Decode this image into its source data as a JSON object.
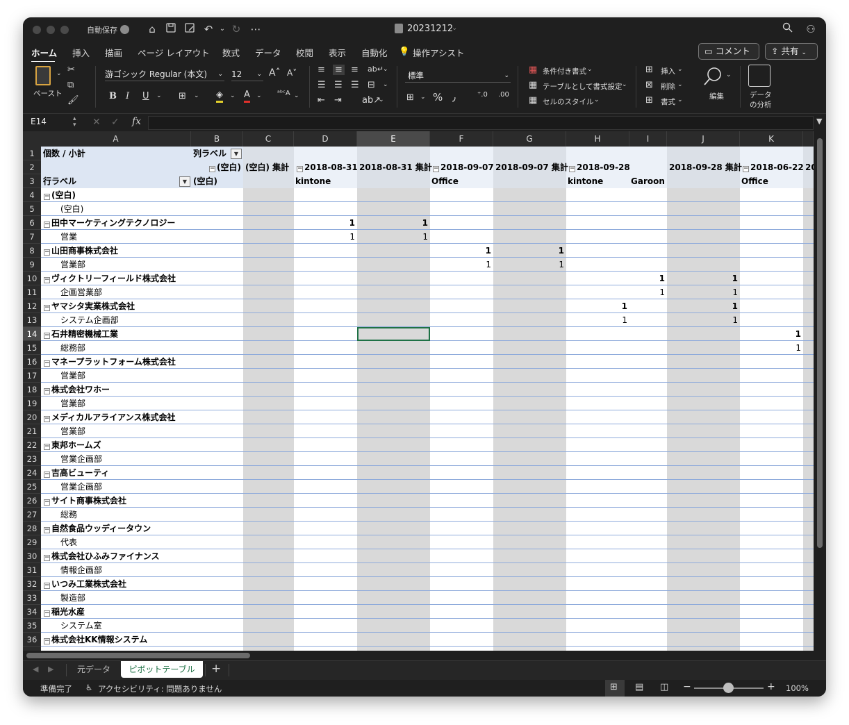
{
  "titlebar": {
    "autosave_label": "自動保存",
    "doc_title": "20231212"
  },
  "ribbon_tabs": [
    "ホーム",
    "挿入",
    "描画",
    "ページ レイアウト",
    "数式",
    "データ",
    "校閲",
    "表示",
    "自動化",
    "操作アシスト"
  ],
  "actions": {
    "comment": "コメント",
    "share": "共有"
  },
  "ribbon": {
    "paste": "ペースト",
    "font_name": "游ゴシック Regular (本文)",
    "font_size": "12",
    "number_format": "標準",
    "conditional_format": "条件付き書式",
    "format_as_table": "テーブルとして書式設定",
    "cell_styles": "セルのスタイル",
    "insert": "挿入",
    "delete": "削除",
    "format": "書式",
    "edit": "編集",
    "analyze_line1": "データ",
    "analyze_line2": "の分析"
  },
  "formula_bar": {
    "name_box": "E14",
    "fx": "fx",
    "formula": ""
  },
  "columns": [
    "A",
    "B",
    "C",
    "D",
    "E",
    "F",
    "G",
    "H",
    "I",
    "J",
    "K"
  ],
  "selected_column": "E",
  "selected_row": 14,
  "pivot": {
    "r1": {
      "a": "個数 / 小計",
      "b": "列ラベル"
    },
    "r2": {
      "b": "(空白)",
      "c": "(空白) 集計",
      "d": "2018-08-31",
      "e": "2018-08-31 集計",
      "f": "2018-09-07",
      "g": "2018-09-07 集計",
      "h": "2018-09-28",
      "j": "2018-09-28 集計",
      "k": "2018-06-22",
      "l": "20"
    },
    "r3": {
      "a": "行ラベル",
      "b": "(空白)",
      "d": "kintone",
      "f": "Office",
      "h": "kintone",
      "i": "Garoon",
      "k": "Office"
    },
    "rows": [
      {
        "n": 4,
        "label": "(空白)",
        "bold": true,
        "minus": true
      },
      {
        "n": 5,
        "label": "(空白)",
        "bold": false,
        "minus": false
      },
      {
        "n": 6,
        "label": "田中マーケティングテクノロジー",
        "bold": true,
        "minus": true,
        "D": "1",
        "E": "1"
      },
      {
        "n": 7,
        "label": "営業",
        "bold": false,
        "minus": false,
        "D": "1",
        "E": "1"
      },
      {
        "n": 8,
        "label": "山田商事株式会社",
        "bold": true,
        "minus": true,
        "F": "1",
        "G": "1"
      },
      {
        "n": 9,
        "label": "営業部",
        "bold": false,
        "minus": false,
        "F": "1",
        "G": "1"
      },
      {
        "n": 10,
        "label": "ヴィクトリーフィールド株式会社",
        "bold": true,
        "minus": true,
        "I": "1",
        "J": "1"
      },
      {
        "n": 11,
        "label": "企画営業部",
        "bold": false,
        "minus": false,
        "I": "1",
        "J": "1"
      },
      {
        "n": 12,
        "label": "ヤマシタ実業株式会社",
        "bold": true,
        "minus": true,
        "H": "1",
        "J": "1"
      },
      {
        "n": 13,
        "label": "システム企画部",
        "bold": false,
        "minus": false,
        "H": "1",
        "J": "1"
      },
      {
        "n": 14,
        "label": "石井精密機械工業",
        "bold": true,
        "minus": true,
        "K": "1"
      },
      {
        "n": 15,
        "label": "総務部",
        "bold": false,
        "minus": false,
        "K": "1"
      },
      {
        "n": 16,
        "label": "マネープラットフォーム株式会社",
        "bold": true,
        "minus": true
      },
      {
        "n": 17,
        "label": "営業部",
        "bold": false,
        "minus": false
      },
      {
        "n": 18,
        "label": "株式会社ワホー",
        "bold": true,
        "minus": true
      },
      {
        "n": 19,
        "label": "営業部",
        "bold": false,
        "minus": false
      },
      {
        "n": 20,
        "label": "メディカルアライアンス株式会社",
        "bold": true,
        "minus": true
      },
      {
        "n": 21,
        "label": "営業部",
        "bold": false,
        "minus": false
      },
      {
        "n": 22,
        "label": "東邦ホームズ",
        "bold": true,
        "minus": true
      },
      {
        "n": 23,
        "label": "営業企画部",
        "bold": false,
        "minus": false
      },
      {
        "n": 24,
        "label": "吉高ビューティ",
        "bold": true,
        "minus": true
      },
      {
        "n": 25,
        "label": "営業企画部",
        "bold": false,
        "minus": false
      },
      {
        "n": 26,
        "label": "サイト商事株式会社",
        "bold": true,
        "minus": true
      },
      {
        "n": 27,
        "label": "総務",
        "bold": false,
        "minus": false
      },
      {
        "n": 28,
        "label": "自然食品ウッディータウン",
        "bold": true,
        "minus": true
      },
      {
        "n": 29,
        "label": "代表",
        "bold": false,
        "minus": false
      },
      {
        "n": 30,
        "label": "株式会社ひふみファイナンス",
        "bold": true,
        "minus": true
      },
      {
        "n": 31,
        "label": "情報企画部",
        "bold": false,
        "minus": false
      },
      {
        "n": 32,
        "label": "いつみ工業株式会社",
        "bold": true,
        "minus": true
      },
      {
        "n": 33,
        "label": "製造部",
        "bold": false,
        "minus": false
      },
      {
        "n": 34,
        "label": "稲光水産",
        "bold": true,
        "minus": true
      },
      {
        "n": 35,
        "label": "システム室",
        "bold": false,
        "minus": false
      },
      {
        "n": 36,
        "label": "株式会社KK情報システム",
        "bold": true,
        "minus": true
      }
    ]
  },
  "sheet_tabs": [
    "元データ",
    "ピボットテーブル"
  ],
  "active_sheet": 1,
  "status": {
    "ready": "準備完了",
    "accessibility": "アクセシビリティ: 問題ありません",
    "zoom": "100%"
  },
  "colors": {
    "window": "#1f1f1f",
    "pivot_header": "#dde6f3",
    "subtotal_band": "#d9d9d9",
    "row_line": "#8eaadb",
    "active_tab_text": "#1e7145"
  }
}
